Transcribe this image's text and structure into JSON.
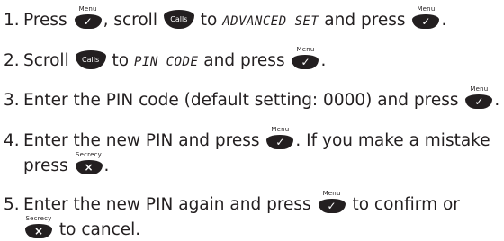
{
  "keys": {
    "menu_caption": "Menu",
    "menu_glyph": "✓",
    "secrecy_caption": "Secrecy",
    "secrecy_glyph": "×",
    "calls_label": "Calls"
  },
  "steps": [
    {
      "num": "1.",
      "t1": "Press",
      "t2": ", scroll",
      "t3": "to",
      "lcd": "ADVANCED SET",
      "t4": "and press",
      "t5": "."
    },
    {
      "num": "2.",
      "t1": "Scroll",
      "t2": "to",
      "lcd": "PIN CODE",
      "t3": "and press",
      "t4": "."
    },
    {
      "num": "3.",
      "t1": "Enter the PIN code (default setting: 0000) and press",
      "t2": "."
    },
    {
      "num": "4.",
      "t1": "Enter the new PIN and press",
      "t2": ". If you make a mistake",
      "t3": "press",
      "t4": "."
    },
    {
      "num": "5.",
      "t1": "Enter the new PIN again and press",
      "t2": "to confirm or",
      "t3": "to cancel."
    }
  ]
}
